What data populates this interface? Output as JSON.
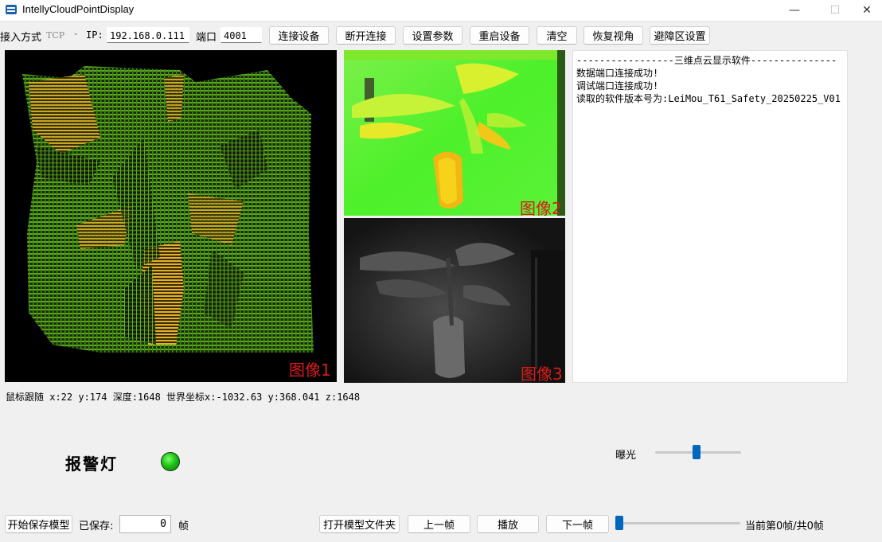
{
  "window": {
    "title": "IntellyCloudPointDisplay",
    "minimize_glyph": "—",
    "maximize_glyph": "☐",
    "close_glyph": "✕"
  },
  "toolbar": {
    "access_mode_label": "接入方式",
    "access_mode_value": "TCP",
    "ip_label": "IP:",
    "ip_value": "192.168.0.111",
    "port_label": "端口",
    "port_value": "4001",
    "buttons": {
      "connect": "连接设备",
      "disconnect": "断开连接",
      "set_params": "设置参数",
      "restart": "重启设备",
      "clear": "清空",
      "reset_view": "恢复视角",
      "avoid_zone": "避障区设置"
    }
  },
  "views": {
    "image1_label": "图像1",
    "image2_label": "图像2",
    "image3_label": "图像3"
  },
  "log": {
    "lines": [
      "-----------------三维点云显示软件---------------",
      "数据端口连接成功!",
      "调试端口连接成功!",
      "读取的软件版本号为:LeiMou_T61_Safety_20250225_V01"
    ]
  },
  "mouse_tracking": {
    "text": "鼠标跟随 x:22 y:174 深度:1648 世界坐标x:-1032.63 y:368.041 z:1648"
  },
  "alarm": {
    "label": "报警灯",
    "color": "#1ec216"
  },
  "exposure": {
    "label": "曝光",
    "level": 0.48
  },
  "bottom_bar": {
    "save_model_button": "开始保存模型",
    "saved_label": "已保存:",
    "saved_value": "0",
    "frame_unit": "帧",
    "open_folder_button": "打开模型文件夹",
    "prev_frame_button": "上一帧",
    "play_button": "播放",
    "next_frame_button": "下一帧",
    "frame_progress": 0,
    "frame_status": "当前第0帧/共0帧"
  },
  "colors": {
    "label_red": "#d91b1b",
    "accent_blue": "#0067c0"
  }
}
